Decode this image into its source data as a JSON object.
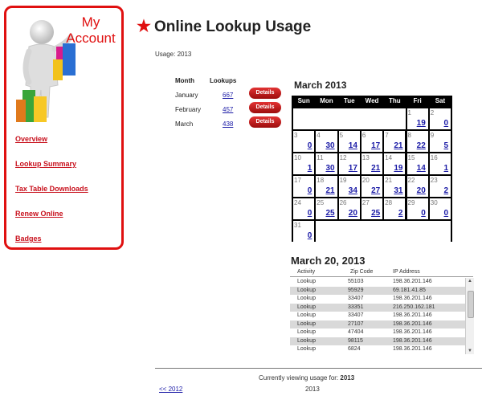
{
  "sidebar": {
    "title_line1": "My",
    "title_line2": "Account",
    "items": [
      {
        "label": "Overview"
      },
      {
        "label": "Lookup Summary"
      },
      {
        "label": "Tax Table Downloads"
      },
      {
        "label": "Renew Online"
      },
      {
        "label": "Badges"
      }
    ]
  },
  "header": {
    "star": "★",
    "title": "Online Lookup Usage"
  },
  "usage": {
    "label": "Usage: 2013"
  },
  "months": {
    "col_month": "Month",
    "col_lookups": "Lookups",
    "rows": [
      {
        "month": "January",
        "lookups": "667",
        "details": "Details"
      },
      {
        "month": "February",
        "lookups": "457",
        "details": "Details"
      },
      {
        "month": "March",
        "lookups": "438",
        "details": "Details"
      }
    ]
  },
  "calendar": {
    "title": "March 2013",
    "weekdays": [
      "Sun",
      "Mon",
      "Tue",
      "Wed",
      "Thu",
      "Fri",
      "Sat"
    ],
    "days": [
      {
        "day": "1",
        "value": "19"
      },
      {
        "day": "2",
        "value": "0"
      },
      {
        "day": "3",
        "value": "0"
      },
      {
        "day": "4",
        "value": "30"
      },
      {
        "day": "5",
        "value": "14"
      },
      {
        "day": "6",
        "value": "17"
      },
      {
        "day": "7",
        "value": "21"
      },
      {
        "day": "8",
        "value": "22"
      },
      {
        "day": "9",
        "value": "5"
      },
      {
        "day": "10",
        "value": "1"
      },
      {
        "day": "11",
        "value": "30"
      },
      {
        "day": "12",
        "value": "17"
      },
      {
        "day": "13",
        "value": "21"
      },
      {
        "day": "14",
        "value": "19"
      },
      {
        "day": "15",
        "value": "14"
      },
      {
        "day": "16",
        "value": "1"
      },
      {
        "day": "17",
        "value": "0"
      },
      {
        "day": "18",
        "value": "21"
      },
      {
        "day": "19",
        "value": "34"
      },
      {
        "day": "20",
        "value": "27"
      },
      {
        "day": "21",
        "value": "31"
      },
      {
        "day": "22",
        "value": "20"
      },
      {
        "day": "23",
        "value": "2"
      },
      {
        "day": "24",
        "value": "0"
      },
      {
        "day": "25",
        "value": "25"
      },
      {
        "day": "26",
        "value": "20"
      },
      {
        "day": "27",
        "value": "25"
      },
      {
        "day": "28",
        "value": "2"
      },
      {
        "day": "29",
        "value": "0"
      },
      {
        "day": "30",
        "value": "0"
      },
      {
        "day": "31",
        "value": "0"
      }
    ]
  },
  "day_detail": {
    "title": "March 20, 2013",
    "columns": [
      "Activity",
      "Zip Code",
      "IP Address"
    ],
    "rows": [
      [
        "Lookup",
        "55103",
        "198.36.201.146"
      ],
      [
        "Lookup",
        "95929",
        "69.181.41.85"
      ],
      [
        "Lookup",
        "33407",
        "198.36.201.146"
      ],
      [
        "Lookup",
        "33351",
        "216.250.162.181"
      ],
      [
        "Lookup",
        "33407",
        "198.36.201.146"
      ],
      [
        "Lookup",
        "27107",
        "198.36.201.146"
      ],
      [
        "Lookup",
        "47404",
        "198.36.201.146"
      ],
      [
        "Lookup",
        "98115",
        "198.36.201.146"
      ],
      [
        "Lookup",
        "6824",
        "198.36.201.146"
      ]
    ]
  },
  "footer": {
    "viewing_text": "Currently viewing usage for:",
    "viewing_year": "2013",
    "prev_link": "<< 2012",
    "current_year": "2013"
  }
}
